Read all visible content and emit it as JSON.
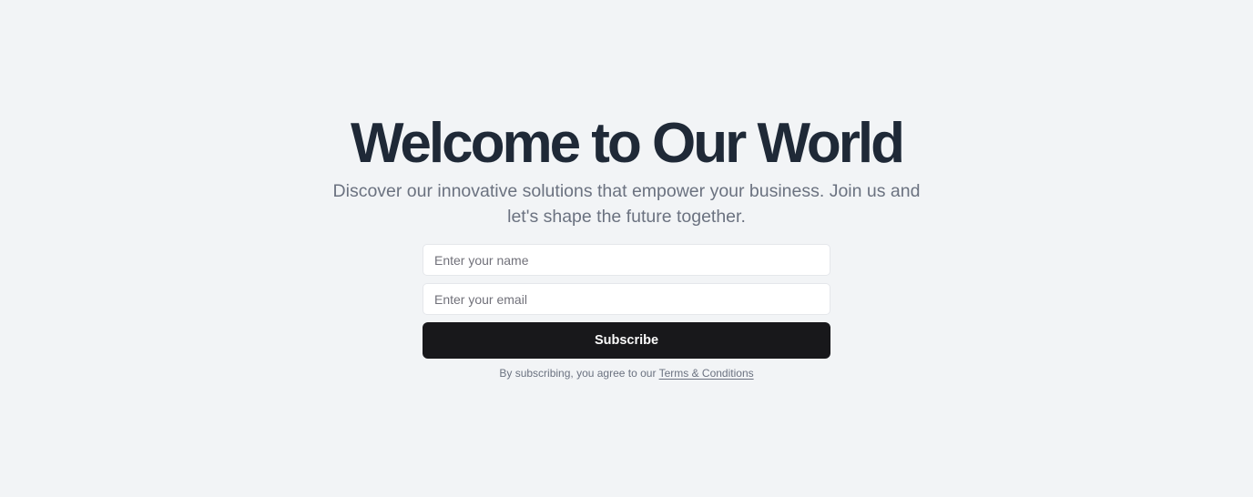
{
  "hero": {
    "title": "Welcome to Our World",
    "subtitle": "Discover our innovative solutions that empower your business. Join us and let's shape the future together."
  },
  "form": {
    "name_placeholder": "Enter your name",
    "email_placeholder": "Enter your email",
    "submit_label": "Subscribe",
    "terms_prefix": "By subscribing, you agree to our ",
    "terms_link": "Terms & Conditions"
  },
  "colors": {
    "background": "#f2f4f6",
    "title": "#1f2937",
    "muted_text": "#6b7280",
    "button": "#18181b",
    "button_text": "#fafafa"
  }
}
